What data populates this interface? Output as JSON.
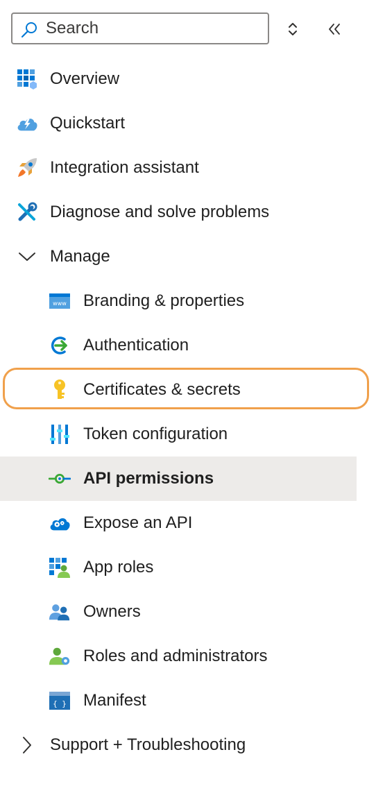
{
  "search": {
    "placeholder": "Search"
  },
  "toolbar": {
    "sort_icon": "up-down-chevron-icon",
    "collapse_icon": "double-chevron-left-icon"
  },
  "nav": {
    "overview": "Overview",
    "quickstart": "Quickstart",
    "integration_assistant": "Integration assistant",
    "diagnose": "Diagnose and solve problems",
    "manage": "Manage",
    "manage_expanded": true,
    "sub": {
      "branding": "Branding & properties",
      "authentication": "Authentication",
      "certificates": "Certificates & secrets",
      "token": "Token configuration",
      "api_permissions": "API permissions",
      "expose_api": "Expose an API",
      "app_roles": "App roles",
      "owners": "Owners",
      "roles_admins": "Roles and administrators",
      "manifest": "Manifest"
    },
    "support": "Support + Troubleshooting",
    "selected": "API permissions",
    "highlighted": "Certificates & secrets"
  },
  "colors": {
    "selected_bg": "#edebe9",
    "highlight_ring": "#f0a04b",
    "accent": "#0078d4"
  }
}
